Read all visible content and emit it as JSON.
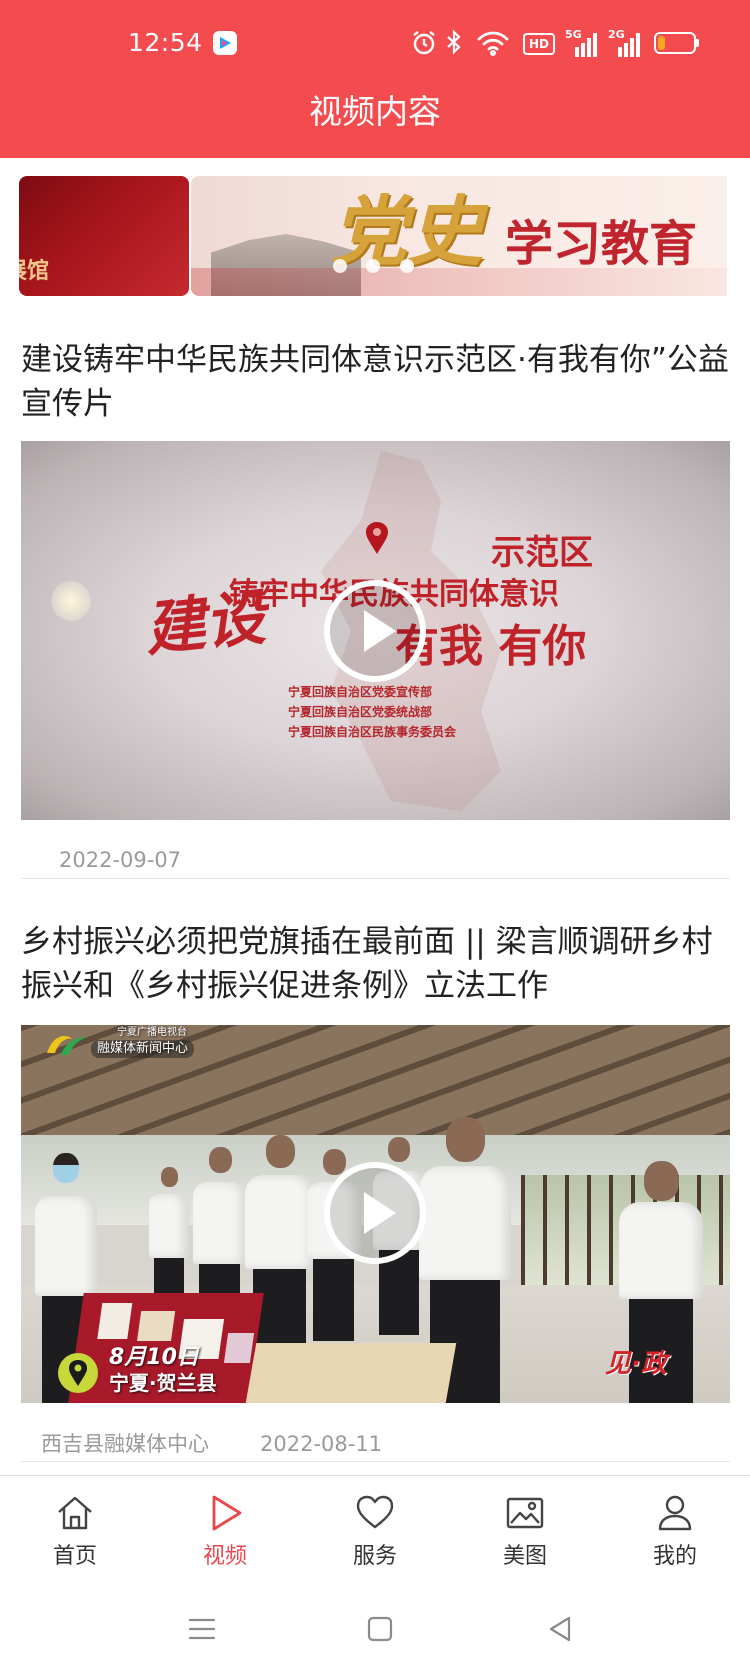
{
  "colors": {
    "brand": "#F44B4E",
    "active": "#E9474C",
    "title_text": "#222222",
    "meta_text": "#9A9A9A",
    "battery_low": "#F5A623"
  },
  "status_bar": {
    "time": "12:54",
    "app_icon": "youku-app-icon",
    "icons": [
      "alarm-icon",
      "bluetooth-icon",
      "wifi-icon",
      "hd-icon",
      "signal-5g-icon",
      "signal-2g-icon",
      "battery-icon"
    ],
    "hd_label": "HD",
    "signal_1_label": "5G",
    "signal_2_label": "2G",
    "battery_level": 0.2
  },
  "header": {
    "title": "视频内容"
  },
  "banner": {
    "slides": [
      {
        "text": "展馆"
      },
      {
        "headline": "党史",
        "text": "学习教育"
      }
    ],
    "dot_count": 3
  },
  "articles": [
    {
      "title": "建设铸牢中华民族共同体意识示范区·有我有你”公益宣传片",
      "date": "2022-09-07",
      "thumbnail": {
        "text_1": "示范区",
        "text_2": "铸牢中华民族共同体意识",
        "text_3": "建设",
        "text_4": "有我 有你",
        "credits": [
          "宁夏回族自治区党委宣传部",
          "宁夏回族自治区党委统战部",
          "宁夏回族自治区民族事务委员会"
        ]
      }
    },
    {
      "title": "乡村振兴必须把党旗插在最前面 || 梁言顺调研乡村振兴和《乡村振兴促进条例》立法工作",
      "source": "西吉县融媒体中心",
      "date": "2022-08-11",
      "thumbnail": {
        "logo_line_1": "宁夏广播电视台",
        "logo_line_2": "融媒体新闻中心",
        "date_text": "8月10日",
        "location": "宁夏·贺兰县",
        "corner_text": "见·政"
      }
    }
  ],
  "bottom_nav": {
    "active_index": 1,
    "items": [
      {
        "label": "首页",
        "icon": "home-icon"
      },
      {
        "label": "视频",
        "icon": "video-play-icon"
      },
      {
        "label": "服务",
        "icon": "heart-icon"
      },
      {
        "label": "美图",
        "icon": "image-icon"
      },
      {
        "label": "我的",
        "icon": "user-icon"
      }
    ]
  },
  "system_nav": {
    "icons": [
      "menu-icon",
      "home-square-icon",
      "back-icon"
    ]
  }
}
